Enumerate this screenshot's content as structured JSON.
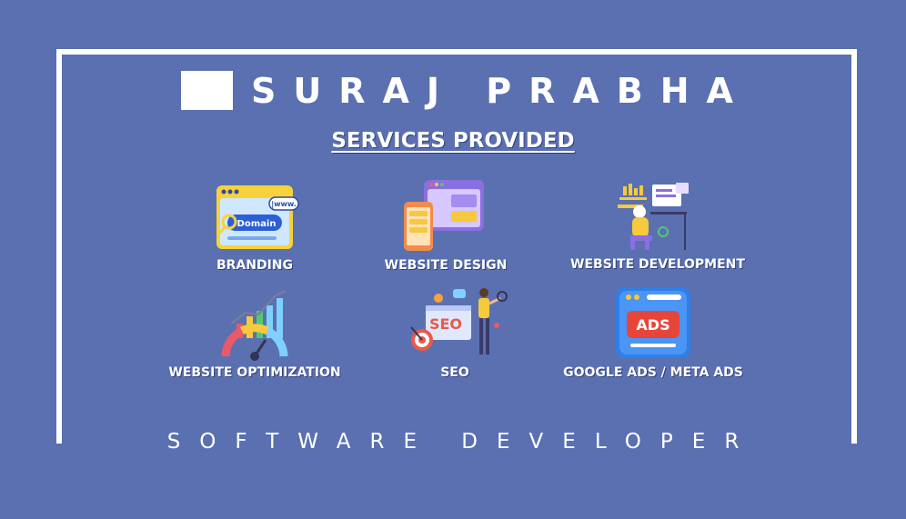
{
  "header": {
    "brand_name": "SURAJ PRABHA",
    "logo_icon": "white-square-logo"
  },
  "services": {
    "title": "SERVICES PROVIDED",
    "items": [
      {
        "label": "BRANDING",
        "icon": "domain-browser-icon"
      },
      {
        "label": "WEBSITE DESIGN",
        "icon": "web-layout-icon"
      },
      {
        "label": "WEBSITE DEVELOPMENT",
        "icon": "developer-at-desk-icon"
      },
      {
        "label": "WEBSITE OPTIMIZATION",
        "icon": "speed-gauge-chart-icon"
      },
      {
        "label": "SEO",
        "icon": "seo-person-icon"
      },
      {
        "label": "GOOGLE ADS / META ADS",
        "icon": "ads-window-icon"
      }
    ],
    "icon_text": {
      "branding_url": "|www.",
      "branding_domain": "Domain",
      "seo_badge": "SEO",
      "ads_badge": "ADS"
    }
  },
  "footer": {
    "tagline": "SOFTWARE DEVELOPER"
  },
  "colors": {
    "background": "#5b70b0",
    "frame": "#ffffff",
    "text": "#ffffff"
  }
}
